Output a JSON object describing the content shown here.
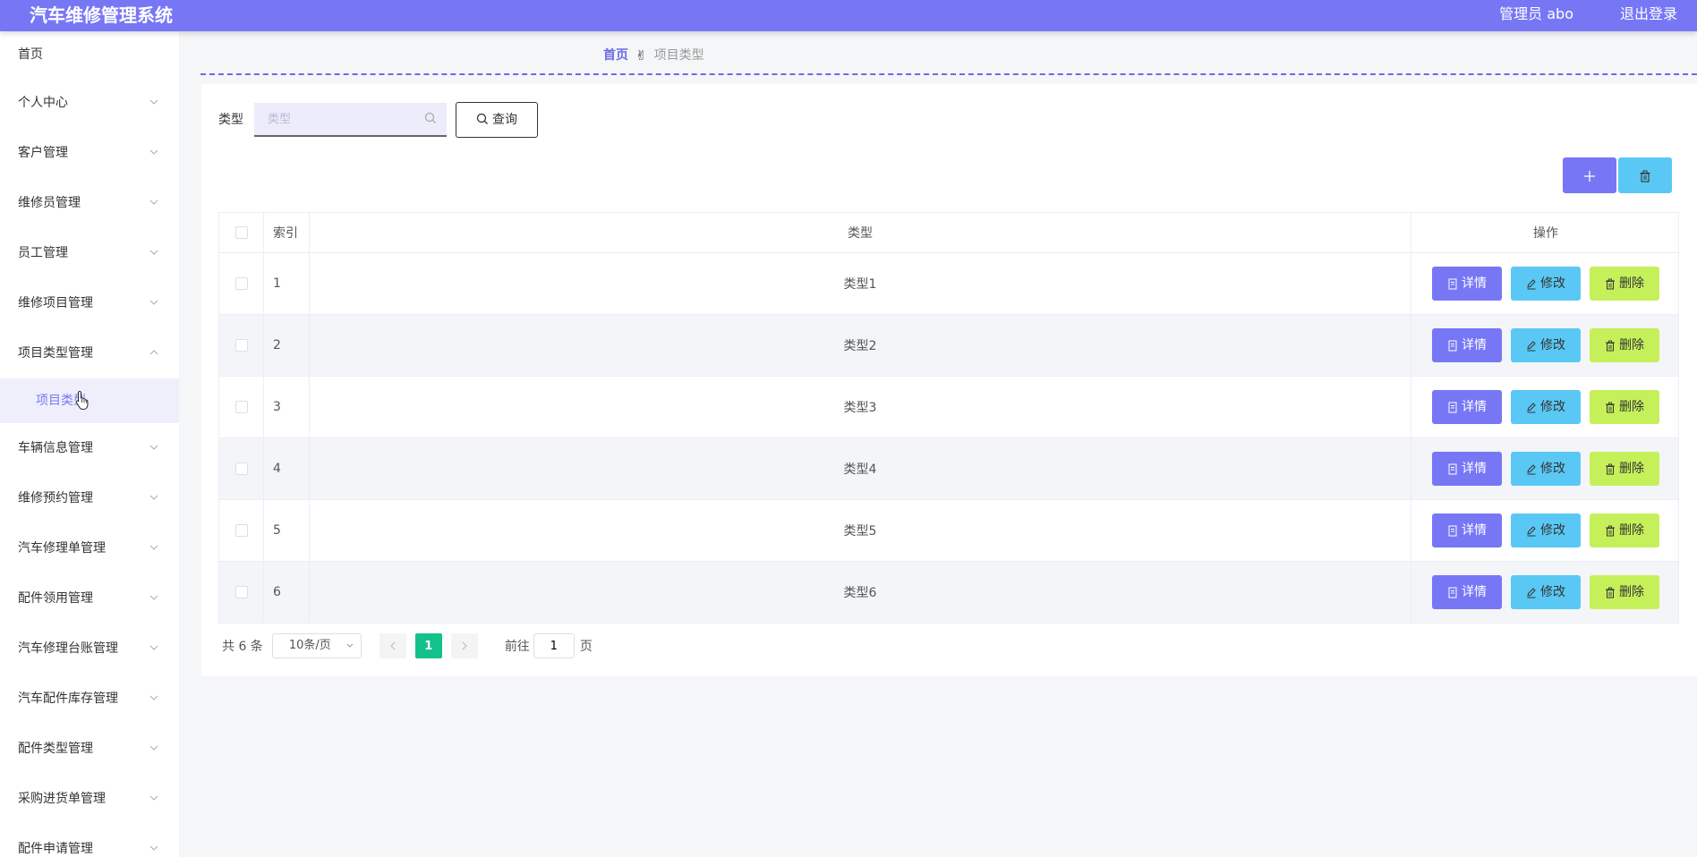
{
  "header": {
    "title": "汽车维修管理系统",
    "admin": "管理员 abo",
    "logout": "退出登录"
  },
  "sidebar": {
    "home": "首页",
    "items": [
      {
        "label": "个人中心",
        "dir": "down"
      },
      {
        "label": "客户管理",
        "dir": "down"
      },
      {
        "label": "维修员管理",
        "dir": "down"
      },
      {
        "label": "员工管理",
        "dir": "down"
      },
      {
        "label": "维修项目管理",
        "dir": "down"
      },
      {
        "label": "项目类型管理",
        "dir": "up"
      }
    ],
    "active_sub": "项目类型",
    "items_after": [
      {
        "label": "车辆信息管理"
      },
      {
        "label": "维修预约管理"
      },
      {
        "label": "汽车修理单管理"
      },
      {
        "label": "配件领用管理"
      },
      {
        "label": "汽车修理台账管理"
      },
      {
        "label": "汽车配件库存管理"
      },
      {
        "label": "配件类型管理"
      },
      {
        "label": "采购进货单管理"
      },
      {
        "label": "配件申请管理"
      }
    ]
  },
  "breadcrumb": {
    "home": "首页",
    "separator": "✌",
    "current": "项目类型"
  },
  "search": {
    "label": "类型",
    "placeholder": "类型",
    "button": "查询"
  },
  "table": {
    "headers": {
      "index": "索引",
      "type": "类型",
      "ops": "操作"
    },
    "rows": [
      {
        "index": "1",
        "type": "类型1"
      },
      {
        "index": "2",
        "type": "类型2"
      },
      {
        "index": "3",
        "type": "类型3"
      },
      {
        "index": "4",
        "type": "类型4"
      },
      {
        "index": "5",
        "type": "类型5"
      },
      {
        "index": "6",
        "type": "类型6"
      }
    ],
    "actions": {
      "detail": "详情",
      "edit": "修改",
      "delete": "删除"
    }
  },
  "pagination": {
    "total": "共 6 条",
    "page_size": "10条/页",
    "current": "1",
    "goto_label": "前往",
    "goto_value": "1",
    "page_suffix": "页"
  },
  "colors": {
    "primary": "#7777f6",
    "info": "#5ac8f5",
    "lime": "#c6f05a",
    "success": "#13c28a"
  }
}
